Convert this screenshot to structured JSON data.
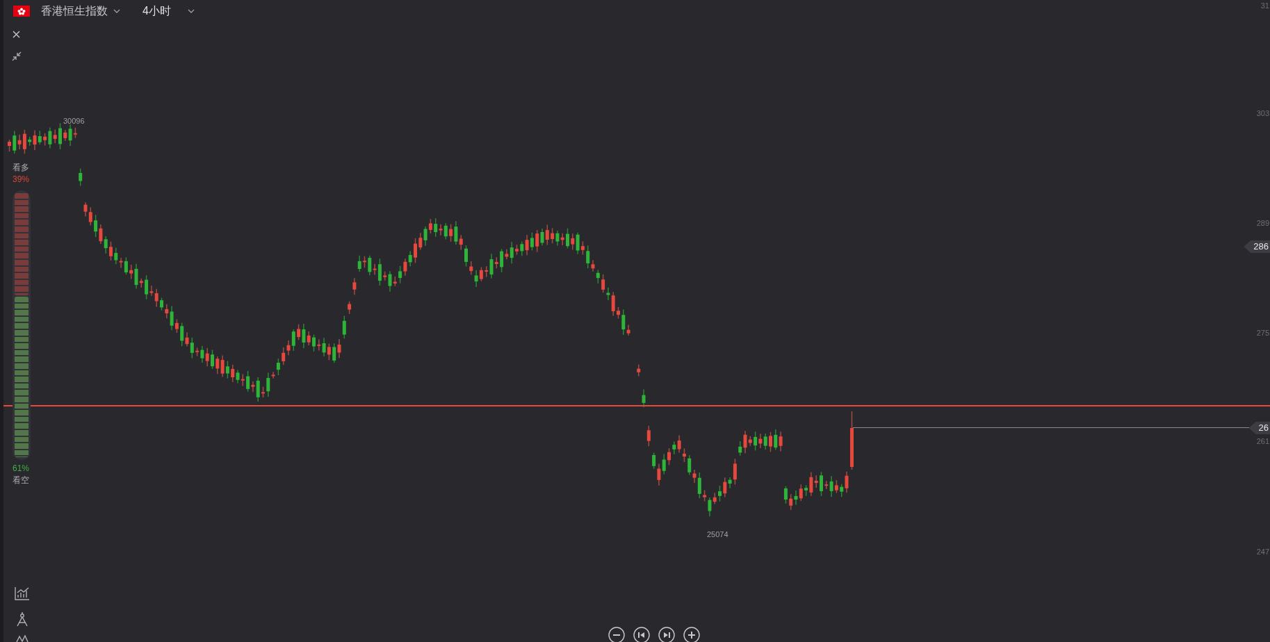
{
  "header": {
    "symbol": "香港恒生指数",
    "timeframe": "4小时"
  },
  "price_axis": {
    "labels": [
      "31",
      "303",
      "289",
      "275",
      "261",
      "247"
    ]
  },
  "price_tags": [
    {
      "text": "286",
      "kind": "marker"
    },
    {
      "text": "26",
      "kind": "current"
    }
  ],
  "annotations": {
    "high": "30096",
    "low": "25074"
  },
  "sentiment": {
    "bull_label": "看多",
    "bull_percent": "39%",
    "bear_percent": "61%",
    "bear_label": "看空",
    "level": 0.39
  }
}
